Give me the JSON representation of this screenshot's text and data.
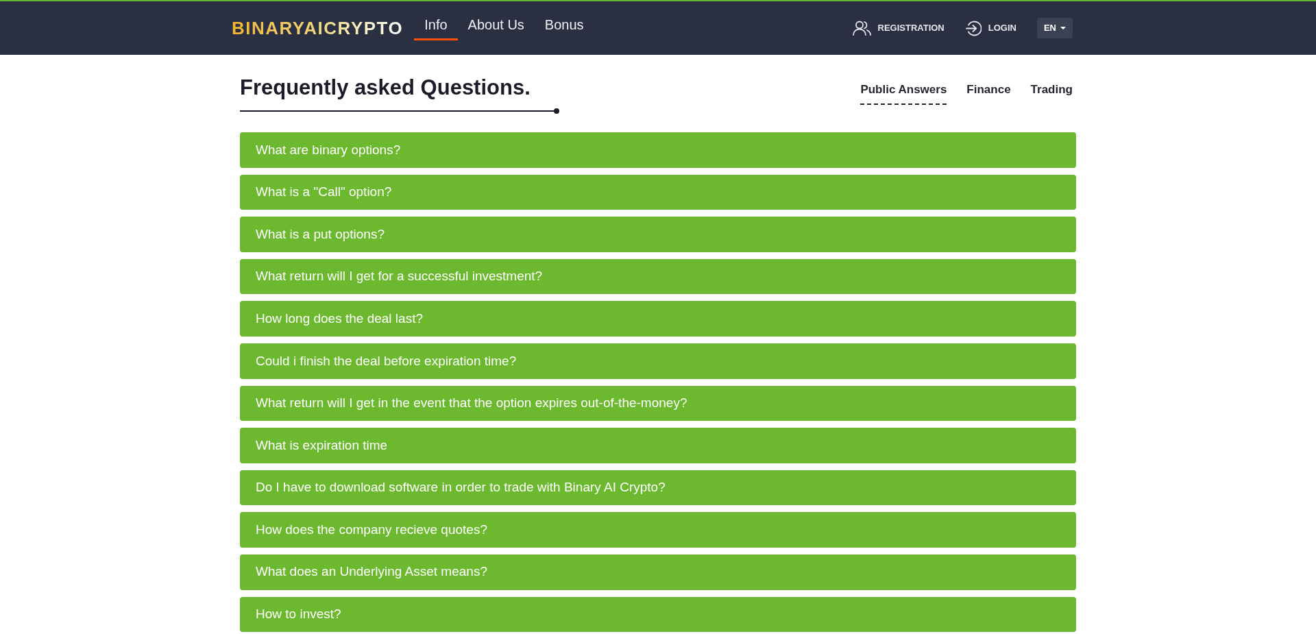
{
  "header": {
    "logo": "BINARYAICRYPTO",
    "nav": [
      {
        "label": "Info",
        "selected": true
      },
      {
        "label": "About Us",
        "selected": false
      },
      {
        "label": "Bonus",
        "selected": false
      }
    ],
    "registration": "REGISTRATION",
    "login": "LOGIN",
    "language": "EN"
  },
  "faq": {
    "title": "Frequently asked Questions.",
    "tabs": [
      {
        "label": "Public Answers",
        "selected": true
      },
      {
        "label": "Finance",
        "selected": false
      },
      {
        "label": "Trading",
        "selected": false
      }
    ],
    "questions": [
      "What are binary options?",
      "What is a \"Call\" option?",
      "What is a put options?",
      "What return will I get for a successful investment?",
      "How long does the deal last?",
      "Could i finish the deal before expiration time?",
      "What return will I get in the event that the option expires out-of-the-money?",
      "What is expiration time",
      "Do I have to download software in order to trade with Binary AI Crypto?",
      "How does the company recieve quotes?",
      "What does an Underlying Asset means?",
      "How to invest?"
    ]
  }
}
